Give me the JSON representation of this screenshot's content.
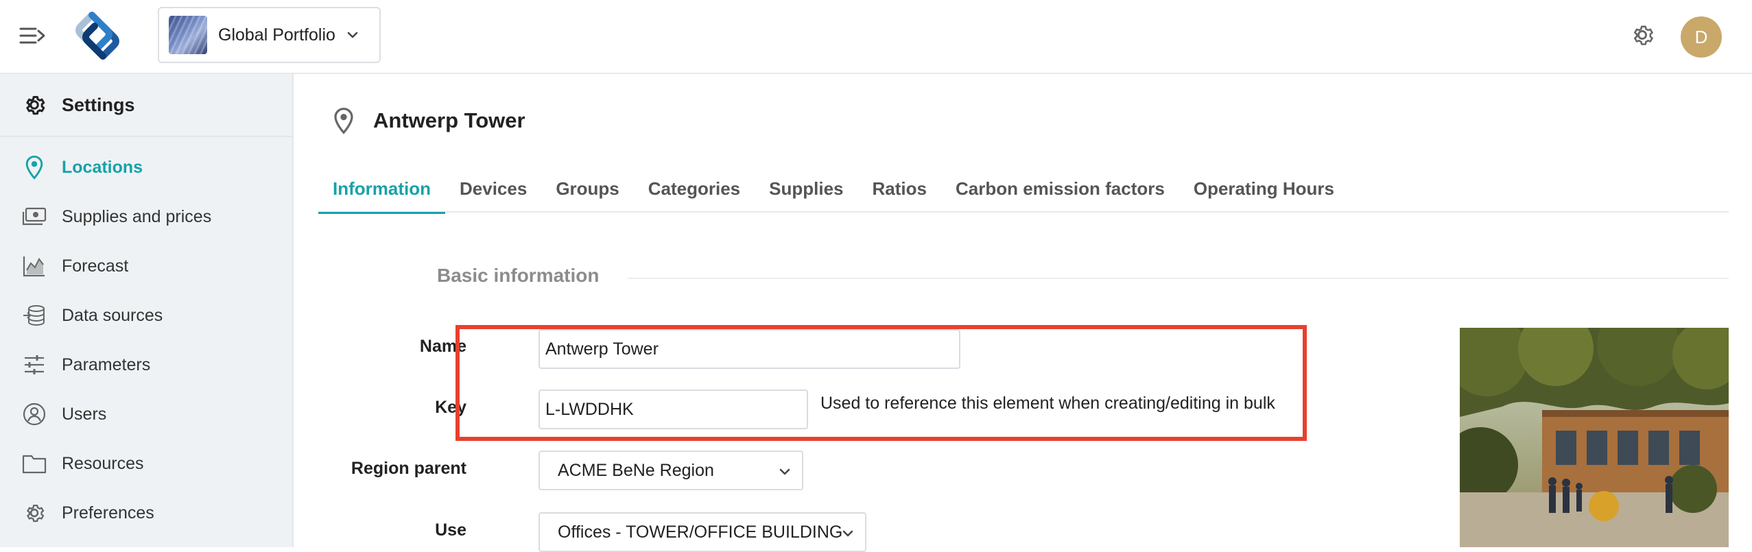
{
  "topbar": {
    "portfolio_name": "Global Portfolio",
    "avatar_initial": "D"
  },
  "sidebar": {
    "settings_label": "Settings",
    "items": [
      {
        "label": "Locations",
        "icon": "map-pin-icon",
        "active": true
      },
      {
        "label": "Supplies and prices",
        "icon": "money-icon"
      },
      {
        "label": "Forecast",
        "icon": "chart-icon"
      },
      {
        "label": "Data sources",
        "icon": "database-icon"
      },
      {
        "label": "Parameters",
        "icon": "sliders-icon"
      },
      {
        "label": "Users",
        "icon": "user-icon"
      },
      {
        "label": "Resources",
        "icon": "folder-icon"
      },
      {
        "label": "Preferences",
        "icon": "gear-icon"
      }
    ]
  },
  "location": {
    "title": "Antwerp Tower"
  },
  "tabs": [
    "Information",
    "Devices",
    "Groups",
    "Categories",
    "Supplies",
    "Ratios",
    "Carbon emission factors",
    "Operating Hours"
  ],
  "active_tab": "Information",
  "form": {
    "section_title": "Basic information",
    "name_label": "Name",
    "name_value": "Antwerp Tower",
    "key_label": "Key",
    "key_value": "L-LWDDHK",
    "key_help": "Used to reference this element when creating/editing in bulk",
    "region_label": "Region parent",
    "region_value": "ACME BeNe Region",
    "use_label": "Use",
    "use_value": "Offices - TOWER/OFFICE BUILDING"
  },
  "colors": {
    "accent": "#17a2a8",
    "highlight": "#e8402e",
    "avatar": "#c9a86a",
    "sidebar_bg": "#eef2f5"
  }
}
